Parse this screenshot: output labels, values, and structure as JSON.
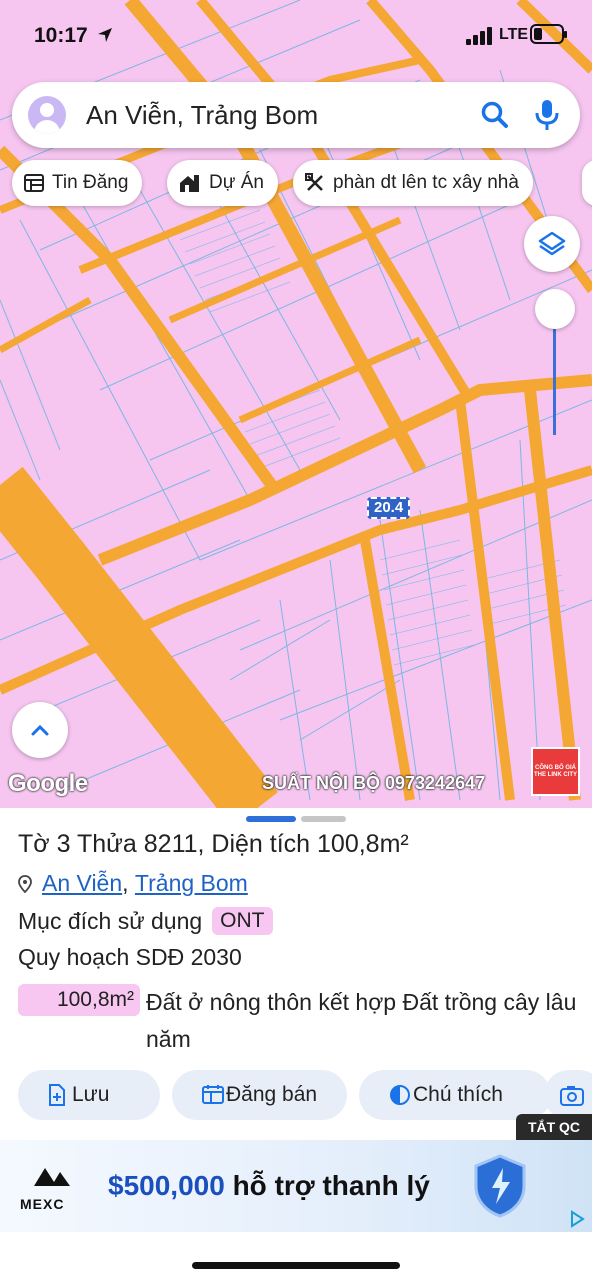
{
  "status_bar": {
    "time": "10:17",
    "network": "LTE"
  },
  "search": {
    "query": "An Viễn, Trảng Bom"
  },
  "chips": [
    {
      "label": "Tin Đăng",
      "icon": "listing-icon"
    },
    {
      "label": "Dự Án",
      "icon": "project-icon"
    },
    {
      "label": "phàn dt lên tc xây nhà",
      "icon": "measure-icon"
    }
  ],
  "map": {
    "parcel_label": "20.4",
    "attribution": "Google",
    "watermark": "SUẤT NỘI BỘ 0973242647",
    "promo_badge": "CÔNG BỐ GIÁ THE LINK CITY",
    "colors": {
      "land": "#f6c6f0",
      "road": "#f5a733",
      "parcel_line": "#5fb4e0"
    }
  },
  "parcel": {
    "title": "Tờ 3 Thửa 8211, Diện tích 100,8m²",
    "ward": "An Viễn",
    "district": "Trảng Bom",
    "purpose_label": "Mục đích sử dụng",
    "purpose_code": "ONT",
    "plan_label": "Quy hoạch SDĐ 2030",
    "area": "100,8m²",
    "land_use": "Đất ở nông thôn kết hợp Đất trồng cây lâu năm"
  },
  "actions": [
    {
      "label": "Lưu",
      "icon": "save-icon"
    },
    {
      "label": "Đăng bán",
      "icon": "post-sale-icon"
    },
    {
      "label": "Chú thích",
      "icon": "legend-icon"
    }
  ],
  "ad": {
    "close_label": "TẮT QC",
    "brand": "MEXC",
    "amount": "$500,000",
    "headline_rest": " hỗ trợ thanh lý"
  }
}
